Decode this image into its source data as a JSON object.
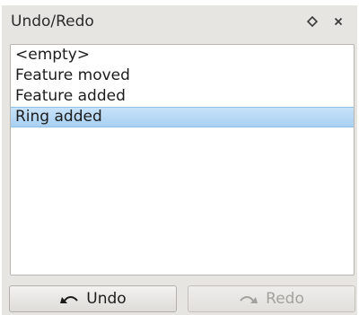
{
  "panel": {
    "title": "Undo/Redo",
    "float_icon": "float-diamond-icon",
    "close_icon": "close-icon"
  },
  "history": {
    "items": [
      {
        "label": "<empty>"
      },
      {
        "label": "Feature moved"
      },
      {
        "label": "Feature added"
      },
      {
        "label": "Ring added",
        "selected": true
      }
    ]
  },
  "buttons": {
    "undo": {
      "label": "Undo",
      "icon": "undo-arrow-icon",
      "enabled": true
    },
    "redo": {
      "label": "Redo",
      "icon": "redo-arrow-icon",
      "enabled": false
    }
  }
}
